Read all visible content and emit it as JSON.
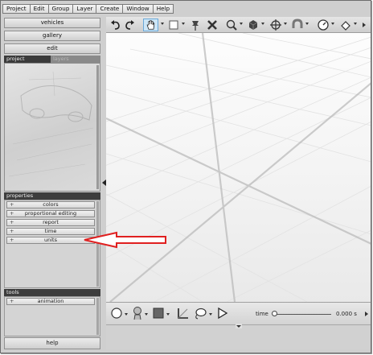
{
  "menu": [
    "Project",
    "Edit",
    "Group",
    "Layer",
    "Create",
    "Window",
    "Help"
  ],
  "left_panel": {
    "buttons": {
      "vehicles": "vehicles",
      "gallery": "gallery",
      "edit": "edit"
    },
    "tabs": {
      "project": "project",
      "layers": "layers"
    },
    "properties": {
      "header": "properties",
      "items": [
        "colors",
        "proportional editing",
        "report",
        "time",
        "units"
      ],
      "expand_glyph": "+"
    },
    "tools": {
      "header": "tools",
      "items": [
        "animation"
      ],
      "expand_glyph": "+"
    },
    "help": "help"
  },
  "toolbar_icons": [
    "undo-icon",
    "redo-icon",
    "pan-hand-icon",
    "select-box-icon",
    "pin-icon",
    "close-x-icon",
    "zoom-icon",
    "cube-icon",
    "move-icon",
    "magnet-icon",
    "clock-icon",
    "rotate-icon"
  ],
  "bottom_bar": {
    "icons": [
      "circle-icon",
      "head-icon",
      "square-icon",
      "corner-icon",
      "lasso-icon",
      "play-icon"
    ],
    "time_label": "time",
    "time_value": "0.000 s",
    "time_position": 0.0
  },
  "annotation": {
    "arrow_color": "#e02020",
    "target": "units"
  },
  "colors": {
    "header_dark": "#3d3d3d",
    "panel_bg": "#d4d4d4",
    "viewport_bg": "#f6f6f6"
  }
}
